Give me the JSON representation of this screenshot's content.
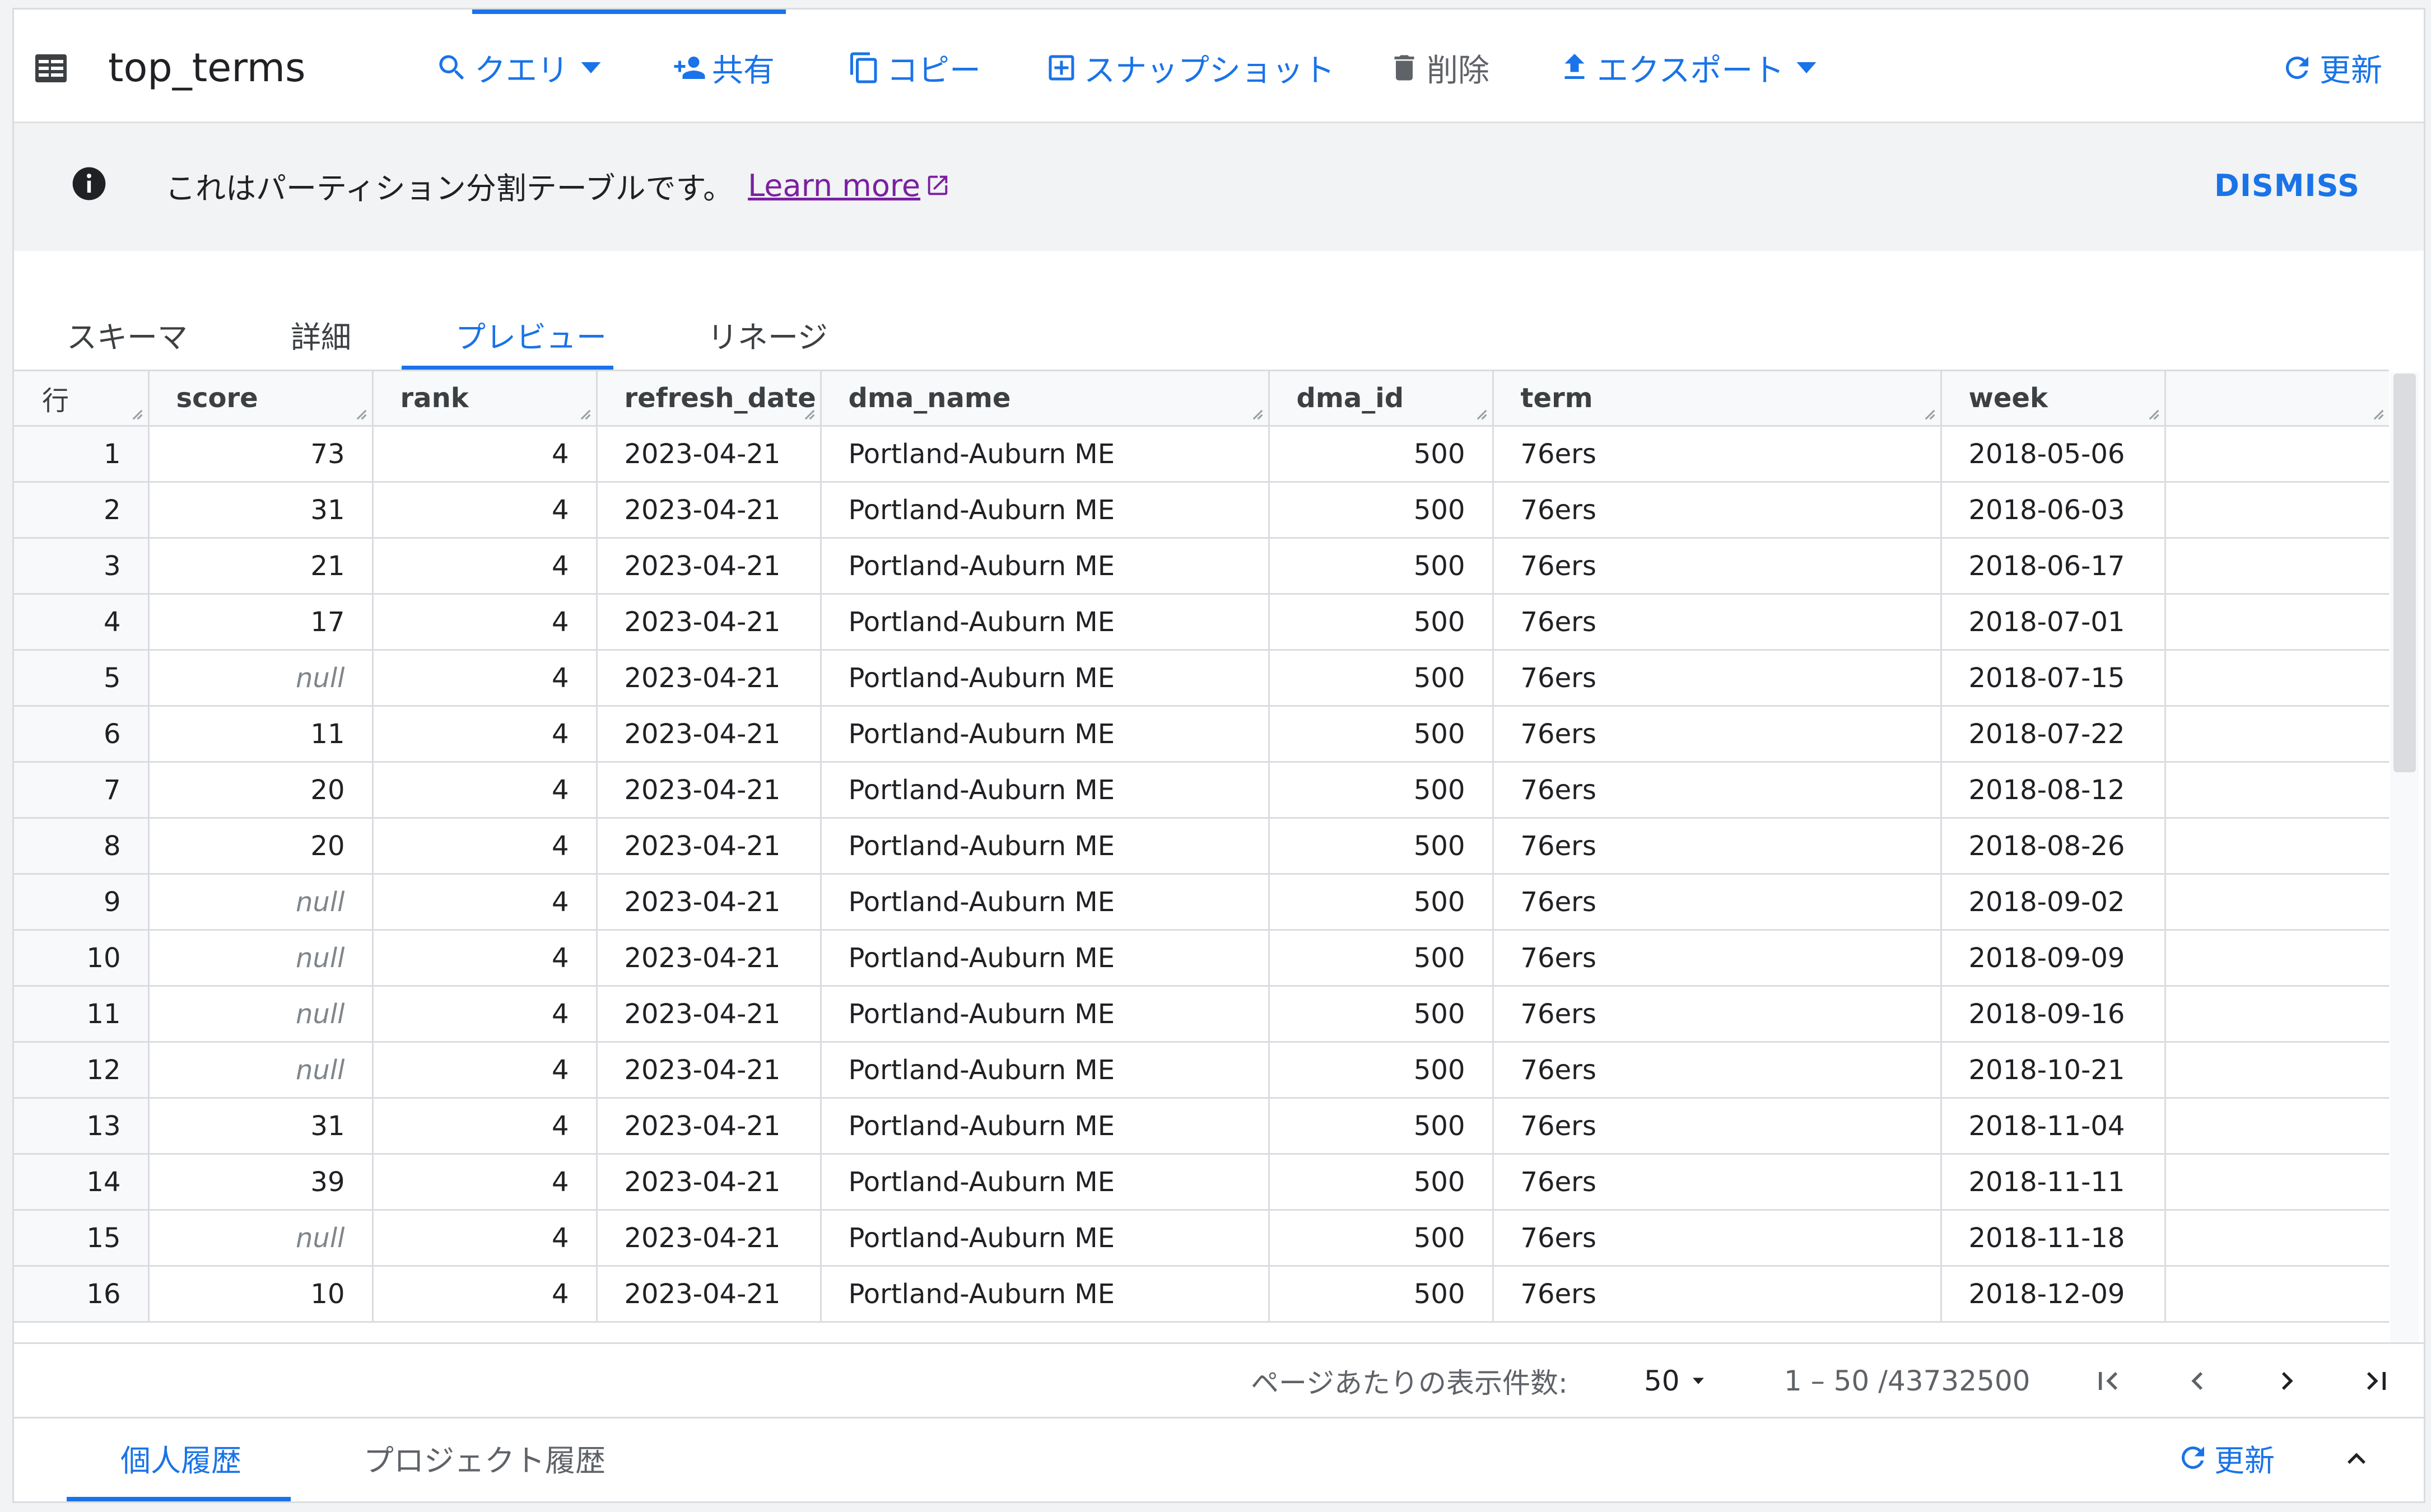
{
  "toolbar": {
    "title": "top_terms",
    "query": "クエリ",
    "share": "共有",
    "copy": "コピー",
    "snapshot": "スナップショット",
    "delete": "削除",
    "export": "エクスポート",
    "refresh": "更新"
  },
  "banner": {
    "message": "これはパーティション分割テーブルです。",
    "learn_more": "Learn more",
    "dismiss": "DISMISS"
  },
  "tabs": [
    "スキーマ",
    "詳細",
    "プレビュー",
    "リネージ"
  ],
  "active_tab": "プレビュー",
  "grid": {
    "columns": [
      "行",
      "score",
      "rank",
      "refresh_date",
      "dma_name",
      "dma_id",
      "term",
      "week"
    ],
    "rows": [
      [
        "1",
        "73",
        "4",
        "2023-04-21",
        "Portland-Auburn ME",
        "500",
        "76ers",
        "2018-05-06"
      ],
      [
        "2",
        "31",
        "4",
        "2023-04-21",
        "Portland-Auburn ME",
        "500",
        "76ers",
        "2018-06-03"
      ],
      [
        "3",
        "21",
        "4",
        "2023-04-21",
        "Portland-Auburn ME",
        "500",
        "76ers",
        "2018-06-17"
      ],
      [
        "4",
        "17",
        "4",
        "2023-04-21",
        "Portland-Auburn ME",
        "500",
        "76ers",
        "2018-07-01"
      ],
      [
        "5",
        "null",
        "4",
        "2023-04-21",
        "Portland-Auburn ME",
        "500",
        "76ers",
        "2018-07-15"
      ],
      [
        "6",
        "11",
        "4",
        "2023-04-21",
        "Portland-Auburn ME",
        "500",
        "76ers",
        "2018-07-22"
      ],
      [
        "7",
        "20",
        "4",
        "2023-04-21",
        "Portland-Auburn ME",
        "500",
        "76ers",
        "2018-08-12"
      ],
      [
        "8",
        "20",
        "4",
        "2023-04-21",
        "Portland-Auburn ME",
        "500",
        "76ers",
        "2018-08-26"
      ],
      [
        "9",
        "null",
        "4",
        "2023-04-21",
        "Portland-Auburn ME",
        "500",
        "76ers",
        "2018-09-02"
      ],
      [
        "10",
        "null",
        "4",
        "2023-04-21",
        "Portland-Auburn ME",
        "500",
        "76ers",
        "2018-09-09"
      ],
      [
        "11",
        "null",
        "4",
        "2023-04-21",
        "Portland-Auburn ME",
        "500",
        "76ers",
        "2018-09-16"
      ],
      [
        "12",
        "null",
        "4",
        "2023-04-21",
        "Portland-Auburn ME",
        "500",
        "76ers",
        "2018-10-21"
      ],
      [
        "13",
        "31",
        "4",
        "2023-04-21",
        "Portland-Auburn ME",
        "500",
        "76ers",
        "2018-11-04"
      ],
      [
        "14",
        "39",
        "4",
        "2023-04-21",
        "Portland-Auburn ME",
        "500",
        "76ers",
        "2018-11-11"
      ],
      [
        "15",
        "null",
        "4",
        "2023-04-21",
        "Portland-Auburn ME",
        "500",
        "76ers",
        "2018-11-18"
      ],
      [
        "16",
        "10",
        "4",
        "2023-04-21",
        "Portland-Auburn ME",
        "500",
        "76ers",
        "2018-12-09"
      ]
    ]
  },
  "pagination": {
    "per_page_label": "ページあたりの表示件数:",
    "per_page": "50",
    "range": "1 – 50 /43732500"
  },
  "bottom_tabs": [
    "個人履歴",
    "プロジェクト履歴"
  ],
  "bottom_refresh": "更新",
  "colors": {
    "accent": "#1a73e8",
    "link_visited": "#7b1fa2",
    "null_text": "#80868b"
  }
}
